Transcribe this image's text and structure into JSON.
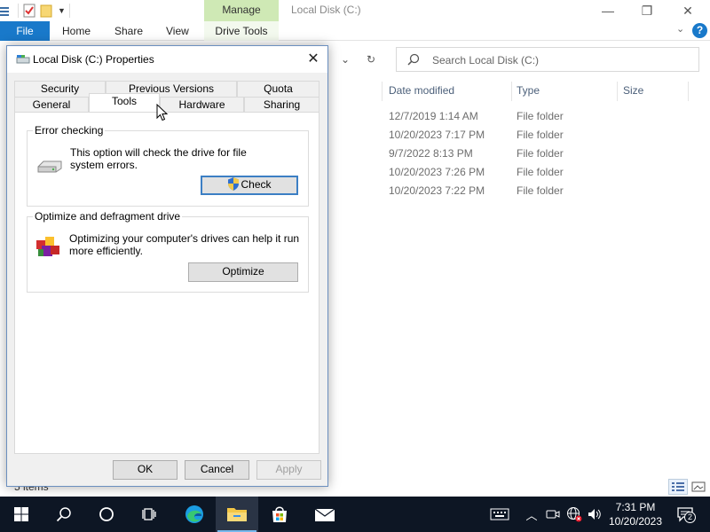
{
  "explorer": {
    "title": "Local Disk (C:)",
    "contextual_tab_header": "Manage",
    "ribbon_tabs": {
      "file": "File",
      "home": "Home",
      "share": "Share",
      "view": "View",
      "drive_tools": "Drive Tools"
    },
    "search_placeholder": "Search Local Disk (C:)",
    "columns": {
      "date_modified": "Date modified",
      "type": "Type",
      "size": "Size"
    },
    "rows": [
      {
        "date": "12/7/2019 1:14 AM",
        "type": "File folder"
      },
      {
        "date": "10/20/2023 7:17 PM",
        "type": "File folder"
      },
      {
        "date": "9/7/2022 8:13 PM",
        "type": "File folder"
      },
      {
        "date": "10/20/2023 7:26 PM",
        "type": "File folder"
      },
      {
        "date": "10/20/2023 7:22 PM",
        "type": "File folder"
      }
    ],
    "status_items": "5 items"
  },
  "dialog": {
    "title": "Local Disk (C:) Properties",
    "tabs_row1": {
      "security": "Security",
      "previous_versions": "Previous Versions",
      "quota": "Quota"
    },
    "tabs_row2": {
      "general": "General",
      "tools": "Tools",
      "hardware": "Hardware",
      "sharing": "Sharing"
    },
    "active_tab": "Tools",
    "error_checking": {
      "title": "Error checking",
      "line1": "This option will check the drive for file",
      "line2": "system errors.",
      "button": "Check"
    },
    "optimize": {
      "title": "Optimize and defragment drive",
      "line1": "Optimizing your computer's drives can help it run",
      "line2": "more efficiently.",
      "button": "Optimize"
    },
    "buttons": {
      "ok": "OK",
      "cancel": "Cancel",
      "apply": "Apply"
    }
  },
  "taskbar": {
    "time": "7:31 PM",
    "date": "10/20/2023",
    "notification_count": "2"
  },
  "colors": {
    "accent_blue": "#1979ca",
    "manage_green": "#cfe9b5",
    "taskbar": "#0d1624"
  }
}
